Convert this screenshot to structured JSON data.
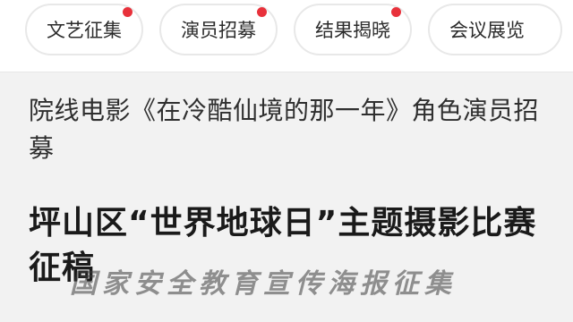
{
  "tabs": [
    {
      "label": "文艺征集",
      "badge": true
    },
    {
      "label": "演员招募",
      "badge": true
    },
    {
      "label": "结果揭晓",
      "badge": true
    },
    {
      "label": "会议展览",
      "badge": false
    }
  ],
  "articles": [
    {
      "title": "院线电影《在冷酷仙境的那一年》角色演员招募"
    },
    {
      "title": "坪山区“世界地球日”主题摄影比赛征稿"
    }
  ],
  "overlay_caption": "国家安全教育宣传海报征集",
  "colors": {
    "badge": "#e8313b",
    "page_bg": "#f2f2f2"
  }
}
